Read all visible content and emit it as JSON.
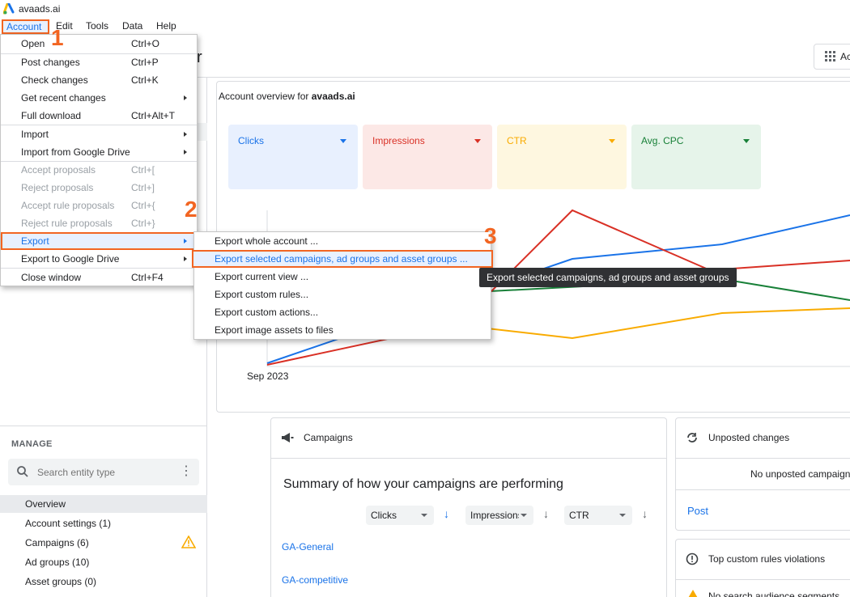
{
  "app": {
    "title": "avaads.ai"
  },
  "menubar": [
    {
      "label": "Account"
    },
    {
      "label": "Edit"
    },
    {
      "label": "Tools"
    },
    {
      "label": "Data"
    },
    {
      "label": "Help"
    }
  ],
  "account_menu": {
    "items": [
      {
        "label": "Open",
        "shortcut": "Ctrl+O"
      },
      {
        "label": "Post changes",
        "shortcut": "Ctrl+P"
      },
      {
        "label": "Check changes",
        "shortcut": "Ctrl+K"
      },
      {
        "label": "Get recent changes",
        "shortcut": ""
      },
      {
        "label": "Full download",
        "shortcut": "Ctrl+Alt+T"
      },
      {
        "label": "Import",
        "shortcut": ""
      },
      {
        "label": "Import from Google Drive",
        "shortcut": ""
      },
      {
        "label": "Accept proposals",
        "shortcut": "Ctrl+["
      },
      {
        "label": "Reject proposals",
        "shortcut": "Ctrl+]"
      },
      {
        "label": "Accept rule proposals",
        "shortcut": "Ctrl+{"
      },
      {
        "label": "Reject rule proposals",
        "shortcut": "Ctrl+}"
      },
      {
        "label": "Export",
        "shortcut": ""
      },
      {
        "label": "Export to Google Drive",
        "shortcut": ""
      },
      {
        "label": "Close window",
        "shortcut": "Ctrl+F4"
      }
    ]
  },
  "export_menu": {
    "items": [
      {
        "label": "Export whole account ..."
      },
      {
        "label": "Export selected campaigns, ad groups and asset groups ..."
      },
      {
        "label": "Export current view ..."
      },
      {
        "label": "Export custom rules..."
      },
      {
        "label": "Export custom actions..."
      },
      {
        "label": "Export image assets to files"
      }
    ]
  },
  "tooltip": "Export selected campaigns, ad groups and asset groups",
  "steps": [
    "1",
    "2",
    "3"
  ],
  "header": {
    "title_fragment": "r",
    "apps_button": "Ac"
  },
  "overview": {
    "title_prefix": "Account overview for ",
    "account_name": "avaads.ai",
    "metrics": [
      {
        "label": "Clicks",
        "color": "#1a73e8"
      },
      {
        "label": "Impressions",
        "color": "#d93025"
      },
      {
        "label": "CTR",
        "color": "#f9ab00"
      },
      {
        "label": "Avg. CPC",
        "color": "#188038"
      }
    ],
    "x_axis_label": "Sep 2023"
  },
  "sidebar": {
    "manage_label": "MANAGE",
    "search_placeholder": "Search entity type",
    "items": [
      {
        "label": "Overview"
      },
      {
        "label": "Account settings (1)"
      },
      {
        "label": "Campaigns (6)"
      },
      {
        "label": "Ad groups (10)"
      },
      {
        "label": "Asset groups (0)"
      }
    ]
  },
  "campaigns_card": {
    "title": "Campaigns",
    "summary": "Summary of how your campaigns are performing",
    "dropdowns": [
      "Clicks",
      "Impressions",
      "CTR"
    ],
    "rows": [
      "GA-General",
      "GA-competitive"
    ]
  },
  "unposted_card": {
    "title": "Unposted changes",
    "message": "No unposted campaign",
    "post_label": "Post"
  },
  "rules_card": {
    "title": "Top custom rules violations",
    "message": "No search audience segments"
  }
}
